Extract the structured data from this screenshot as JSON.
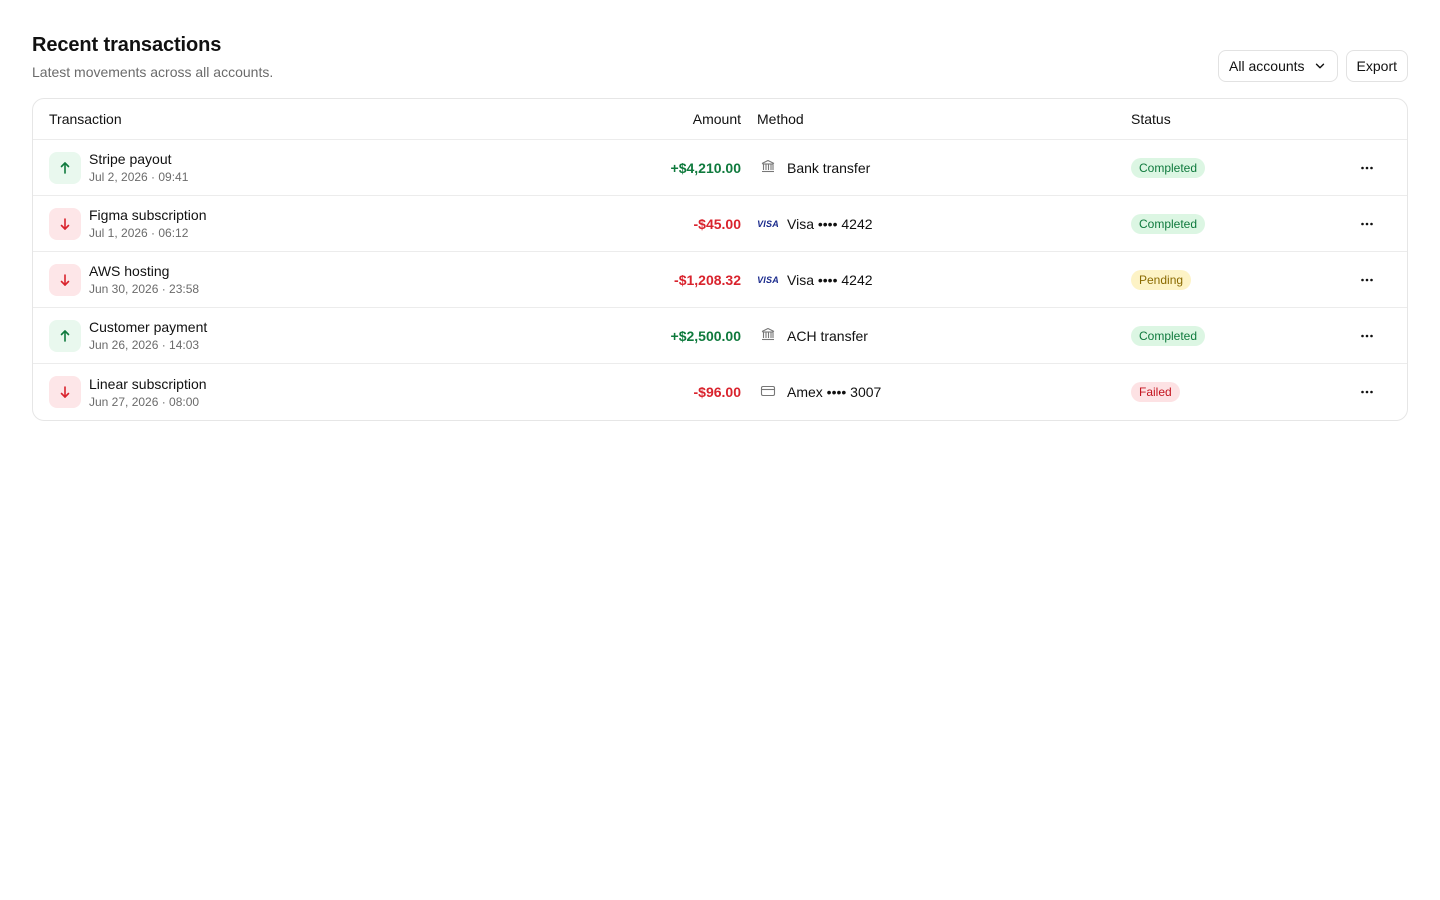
{
  "header": {
    "title": "Recent transactions",
    "subtitle": "Latest movements across all accounts.",
    "filter_label": "All accounts",
    "export_label": "Export"
  },
  "table": {
    "columns": {
      "transaction": "Transaction",
      "amount": "Amount",
      "method": "Method",
      "status": "Status"
    },
    "rows": [
      {
        "direction": "in",
        "name": "Stripe payout",
        "date": "Jul 2, 2026 · 09:41",
        "amount": "+$4,210.00",
        "method_icon": "bank-icon",
        "method": "Bank transfer",
        "status": "Completed",
        "status_kind": "completed"
      },
      {
        "direction": "out",
        "name": "Figma subscription",
        "date": "Jul 1, 2026 · 06:12",
        "amount": "-$45.00",
        "method_icon": "visa-icon",
        "method": "Visa •••• 4242",
        "status": "Completed",
        "status_kind": "completed"
      },
      {
        "direction": "out",
        "name": "AWS hosting",
        "date": "Jun 30, 2026 · 23:58",
        "amount": "-$1,208.32",
        "method_icon": "visa-icon",
        "method": "Visa •••• 4242",
        "status": "Pending",
        "status_kind": "pending"
      },
      {
        "direction": "in",
        "name": "Customer payment",
        "date": "Jun 26, 2026 · 14:03",
        "amount": "+$2,500.00",
        "method_icon": "bank-icon",
        "method": "ACH transfer",
        "status": "Completed",
        "status_kind": "completed"
      },
      {
        "direction": "out",
        "name": "Linear subscription",
        "date": "Jun 27, 2026 · 08:00",
        "amount": "-$96.00",
        "method_icon": "card-icon",
        "method": "Amex •••• 3007",
        "status": "Failed",
        "status_kind": "failed"
      }
    ]
  },
  "brand": {
    "visa_text": "VISA"
  },
  "colors": {
    "positive": "#0f7a3d",
    "negative": "#d9232d",
    "completed_bg": "#dcf6e3",
    "pending_bg": "#fdf3c6",
    "failed_bg": "#fde2e4"
  }
}
